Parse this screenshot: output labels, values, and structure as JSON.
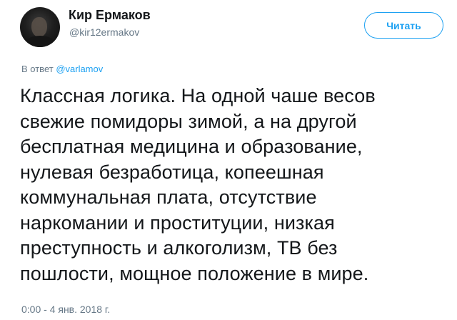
{
  "author": {
    "display_name": "Кир Ермаков",
    "username": "@kir12ermakov"
  },
  "follow_button": {
    "label": "Читать"
  },
  "reply": {
    "prefix": "В ответ ",
    "mention": "@varlamov"
  },
  "tweet": {
    "lines": [
      "Классная логика. На одной чаше весов",
      "свежие помидоры зимой, а на другой",
      "бесплатная медицина и образование,",
      "нулевая безработица, копеешная",
      "коммунальная плата, отсутствие",
      "наркомании и проституции, низкая",
      "преступность и алкоголизм, ТВ без",
      "пошлости, мощное положение в мире."
    ]
  },
  "timestamp": "0:00 - 4 янв. 2018 г.",
  "colors": {
    "accent": "#1da1f2",
    "secondary_text": "#657786",
    "primary_text": "#14171a"
  }
}
